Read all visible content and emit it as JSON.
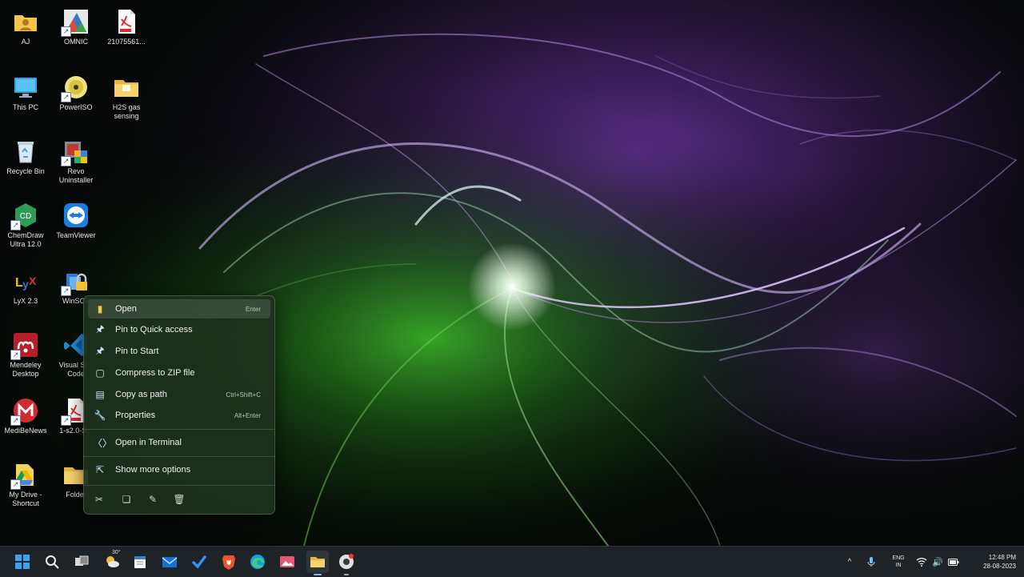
{
  "desktop": {
    "icons": [
      {
        "label": "AJ"
      },
      {
        "label": "OMNIC"
      },
      {
        "label": "21075561..."
      },
      {
        "label": "This PC"
      },
      {
        "label": "PowerISO"
      },
      {
        "label": "H2S gas\nsensing"
      },
      {
        "label": "Recycle Bin"
      },
      {
        "label": "Revo\nUninstaller"
      },
      {
        "label": "ChemDraw\nUltra 12.0"
      },
      {
        "label": "TeamViewer"
      },
      {
        "label": "LyX 2.3"
      },
      {
        "label": "WinSCP"
      },
      {
        "label": "Mendeley\nDesktop"
      },
      {
        "label": "Visual St...\nCode"
      },
      {
        "label": "MediBeNews"
      },
      {
        "label": "1-s2.0-S..."
      },
      {
        "label": "My Drive -\nShortcut"
      },
      {
        "label": "Folder"
      }
    ]
  },
  "context_menu": {
    "items": [
      {
        "label": "Open",
        "shortcut": "Enter"
      },
      {
        "label": "Pin to Quick access",
        "shortcut": ""
      },
      {
        "label": "Pin to Start",
        "shortcut": ""
      },
      {
        "label": "Compress to ZIP file",
        "shortcut": ""
      },
      {
        "label": "Copy as path",
        "shortcut": "Ctrl+Shift+C"
      },
      {
        "label": "Properties",
        "shortcut": "Alt+Enter"
      },
      {
        "label": "Open in Terminal",
        "shortcut": ""
      },
      {
        "label": "Show more options",
        "shortcut": ""
      }
    ],
    "actions": [
      "cut-icon",
      "copy-icon",
      "rename-icon",
      "delete-icon"
    ]
  },
  "taskbar": {
    "weather_temp": "30°",
    "language": "ENG",
    "region": "IN",
    "time": "12:48 PM",
    "date": "28-08-2023",
    "colors": {
      "accent": "#0a84ff",
      "bg": "#1d2326"
    }
  }
}
